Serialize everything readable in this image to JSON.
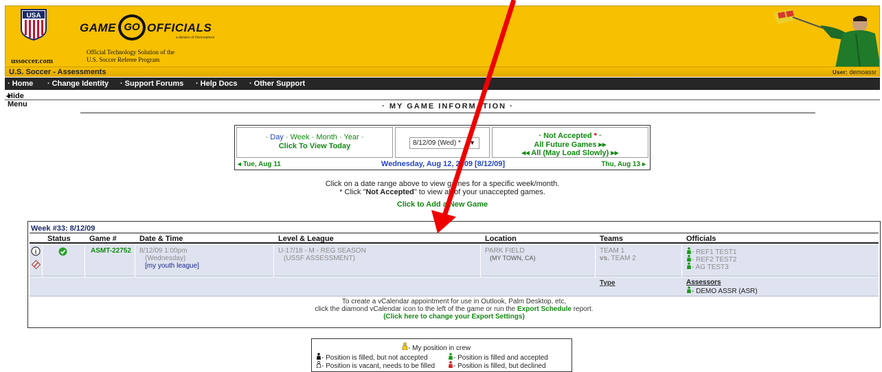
{
  "header": {
    "site_label": "ussoccer.com",
    "usflag_text": "USA",
    "logo_game": "GAME",
    "logo_circle": "GO",
    "logo_officials": "OFFICIALS",
    "logo_division": "a division of Demosphere",
    "tagline_line1": "Official Technology Solution of the",
    "tagline_line2": "U.S. Soccer Referee Program"
  },
  "assess_bar": {
    "title": "U.S. Soccer - Assessments",
    "user_label": "User:",
    "user_name": "demoassr"
  },
  "nav": {
    "items": [
      "Home",
      "Change Identity",
      "Support Forums",
      "Help Docs",
      "Other Support"
    ]
  },
  "hide_menu": "Hide Menu",
  "section_title": "· MY GAME INFORMATION ·",
  "date_selector": {
    "day": "Day",
    "week": "Week",
    "month": "Month",
    "year": "Year",
    "today": "Click To View Today",
    "select_value": "8/12/09 (Wed) *",
    "not_accepted": "Not Accepted",
    "all_future": "All Future Games",
    "all_slow": "All (May Load Slowly)",
    "prev_day": "Tue, Aug 11",
    "current_day": "Wednesday, Aug 12, 2009  [8/12/09]",
    "next_day": "Thu, Aug 13"
  },
  "hints": {
    "line1": "Click on a date range above to view games for a specific week/month.",
    "line2_pre": "* Click \"",
    "line2_bold": "Not Accepted",
    "line2_post": "\" to view all of your unaccepted games.",
    "add_game": "Click to Add a New Game"
  },
  "games": {
    "week_label": "Week #33:  8/12/09",
    "columns": {
      "status": "Status",
      "game": "Game #",
      "datetime": "Date & Time",
      "level": "Level & League",
      "location": "Location",
      "teams": "Teams",
      "officials": "Officials"
    },
    "row": {
      "game_number": "ASMT-22752",
      "date_line1": "8/12/09  1:00pm",
      "date_line2": "(Wednesday)",
      "date_line3": "[my youth league]",
      "level_line1": "U-17/18 - M - REG SEASON",
      "level_line2": "(USSF ASSESSMENT)",
      "location_line1": "PARK FIELD",
      "location_line2": "(MY TOWN, CA)",
      "team1": "TEAM 1",
      "team2_prefix": "vs.",
      "team2": "TEAM 2",
      "officials": [
        "- REF1 TEST1",
        "- REF2 TEST2",
        "- AG TEST3"
      ],
      "type_label": "Type",
      "assessors_label": "Assessors",
      "assessor": "- DEMO ASSR (ASR)"
    },
    "export_line1": "To create a vCalendar appointment for use in Outlook, Palm Desktop, etc,",
    "export_line2_pre": "click the diamond vCalendar icon to the left of the game or run the",
    "export_line2_link": "Export Schedule",
    "export_line2_post": "report.",
    "export_line3": "(Click here to change your Export Settings)"
  },
  "legend": {
    "my_position": "- My position in crew",
    "filled_not_accepted": "- Position is filled, but not accepted",
    "filled_accepted": "- Position is filled and accepted",
    "vacant": "- Position is vacant, needs to be filled",
    "declined": "- Position is filled, but declined"
  },
  "colors": {
    "header_gold": "#f7c000",
    "nav_dark": "#262626",
    "link_green": "#128a12",
    "link_blue": "#2244cc",
    "row_bg": "#dfe3f0",
    "arrow_red": "#ee0000"
  }
}
